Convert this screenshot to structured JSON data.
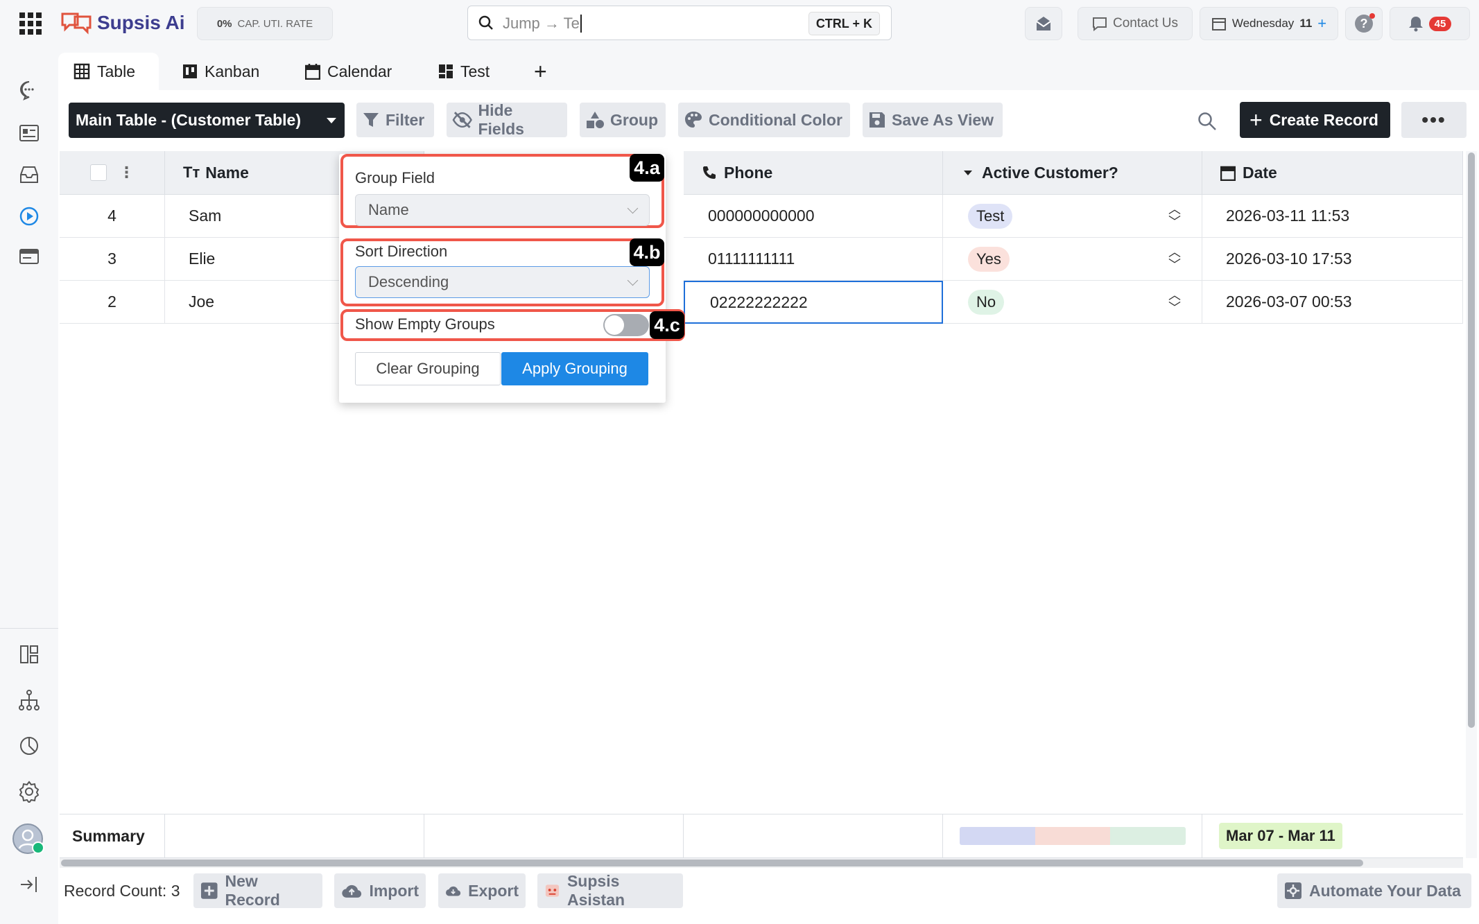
{
  "app": {
    "name": "Supsis Ai"
  },
  "topbar": {
    "cap_value": "0%",
    "cap_label": "CAP. UTI. RATE",
    "search_value": "Jump → Te",
    "shortcut": "CTRL + K",
    "contact_label": "Contact Us",
    "day_label": "Wednesday",
    "day_number": "11",
    "notification_count": "45"
  },
  "tabs": [
    {
      "label": "Table",
      "icon": "table-icon"
    },
    {
      "label": "Kanban",
      "icon": "kanban-icon"
    },
    {
      "label": "Calendar",
      "icon": "calendar-icon"
    },
    {
      "label": "Test",
      "icon": "dashboard-icon"
    }
  ],
  "toolbar": {
    "table_selector": "Main Table - (Customer Table)",
    "filter": "Filter",
    "hide_fields": "Hide Fields",
    "group": "Group",
    "conditional_color": "Conditional Color",
    "save_as_view": "Save As View",
    "create_record": "Create Record"
  },
  "table": {
    "columns": {
      "name": "Name",
      "phone": "Phone",
      "active": "Active Customer?",
      "date": "Date"
    },
    "rows": [
      {
        "id": "4",
        "name": "Sam",
        "phone": "000000000000",
        "active": "Test",
        "date": "2026-03-11 11:53"
      },
      {
        "id": "3",
        "name": "Elie",
        "phone": "01111111111",
        "active": "Yes",
        "date": "2026-03-10 17:53"
      },
      {
        "id": "2",
        "name": "Joe",
        "phone": "02222222222",
        "active": "No",
        "date": "2026-03-07 00:53"
      }
    ],
    "summary_label": "Summary",
    "summary_date": "Mar 07 - Mar 11"
  },
  "group_popup": {
    "group_field_label": "Group Field",
    "group_field_value": "Name",
    "sort_direction_label": "Sort Direction",
    "sort_direction_value": "Descending",
    "show_empty_label": "Show Empty Groups",
    "show_empty_enabled": false,
    "clear_label": "Clear Grouping",
    "apply_label": "Apply Grouping",
    "tags": [
      "4.a",
      "4.b",
      "4.c"
    ]
  },
  "footer": {
    "record_count": "Record Count: 3",
    "new_record": "New Record",
    "import": "Import",
    "export": "Export",
    "asistan": "Supsis Asistan",
    "automate": "Automate Your Data"
  },
  "colors": {
    "accent_blue": "#1e88e5",
    "highlight_red": "#f0574a",
    "dark_button": "#1e2329",
    "badge_test": "#dfe3f7",
    "badge_yes": "#fbe1dc",
    "badge_no": "#dff3e6",
    "summary_date_bg": "#dff5c8"
  }
}
